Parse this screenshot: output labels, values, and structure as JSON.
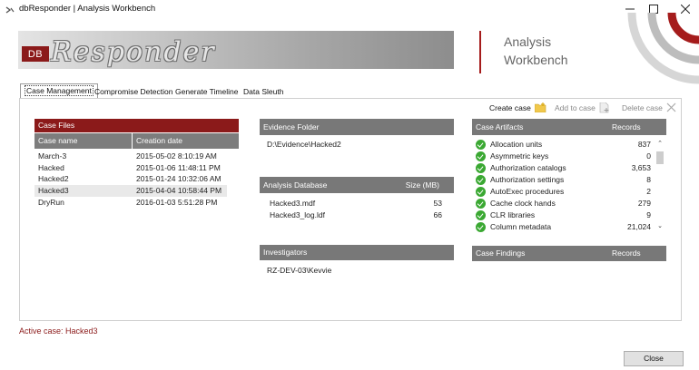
{
  "window": {
    "title": "dbResponder  |  Analysis Workbench",
    "minimize": "—",
    "maximize": "☐",
    "close": "✕"
  },
  "banner": {
    "logo_badge": "DB",
    "logo_text": "Responder",
    "subtitle_line1": "Analysis",
    "subtitle_line2": "Workbench"
  },
  "tabs": [
    {
      "label": "Case Management",
      "active": true
    },
    {
      "label": "Compromise Detection",
      "active": false
    },
    {
      "label": "Generate Timeline",
      "active": false
    },
    {
      "label": "Data Sleuth",
      "active": false
    }
  ],
  "toolbar": {
    "create_case": "Create case",
    "add_to_case": "Add to case",
    "delete_case": "Delete case"
  },
  "case_files": {
    "header": "Case Files",
    "col_name": "Case name",
    "col_date": "Creation date",
    "rows": [
      {
        "name": "March-3",
        "date": "2015-05-02 8:10:19 AM"
      },
      {
        "name": "Hacked",
        "date": "2015-01-06 11:48:11 PM"
      },
      {
        "name": "Hacked2",
        "date": "2015-01-24 10:32:06 AM"
      },
      {
        "name": "Hacked3",
        "date": "2015-04-04 10:58:44 PM"
      },
      {
        "name": "DryRun",
        "date": "2016-01-03 5:51:28 PM"
      }
    ]
  },
  "evidence": {
    "header": "Evidence Folder",
    "path": "D:\\Evidence\\Hacked2"
  },
  "analysis_db": {
    "header": "Analysis Database",
    "size_header": "Size (MB)",
    "rows": [
      {
        "name": "Hacked3.mdf",
        "size": "53"
      },
      {
        "name": "Hacked3_log.ldf",
        "size": "66"
      }
    ]
  },
  "investigators": {
    "header": "Investigators",
    "name": "RZ-DEV-03\\Kevvie"
  },
  "artifacts": {
    "header": "Case Artifacts",
    "records_header": "Records",
    "rows": [
      {
        "name": "Allocation units",
        "count": "837"
      },
      {
        "name": "Asymmetric keys",
        "count": "0"
      },
      {
        "name": "Authorization catalogs",
        "count": "3,653"
      },
      {
        "name": "Authorization settings",
        "count": "8"
      },
      {
        "name": "AutoExec procedures",
        "count": "2"
      },
      {
        "name": "Cache clock hands",
        "count": "279"
      },
      {
        "name": "CLR libraries",
        "count": "9"
      },
      {
        "name": "Column metadata",
        "count": "21,024"
      }
    ]
  },
  "findings": {
    "header": "Case Findings",
    "records_header": "Records"
  },
  "status": {
    "active_case": "Active case: Hacked3"
  },
  "footer": {
    "close_label": "Close"
  },
  "colors": {
    "brand_red": "#8b1a1a",
    "header_grey": "#787878",
    "ok_green": "#3aa832"
  }
}
